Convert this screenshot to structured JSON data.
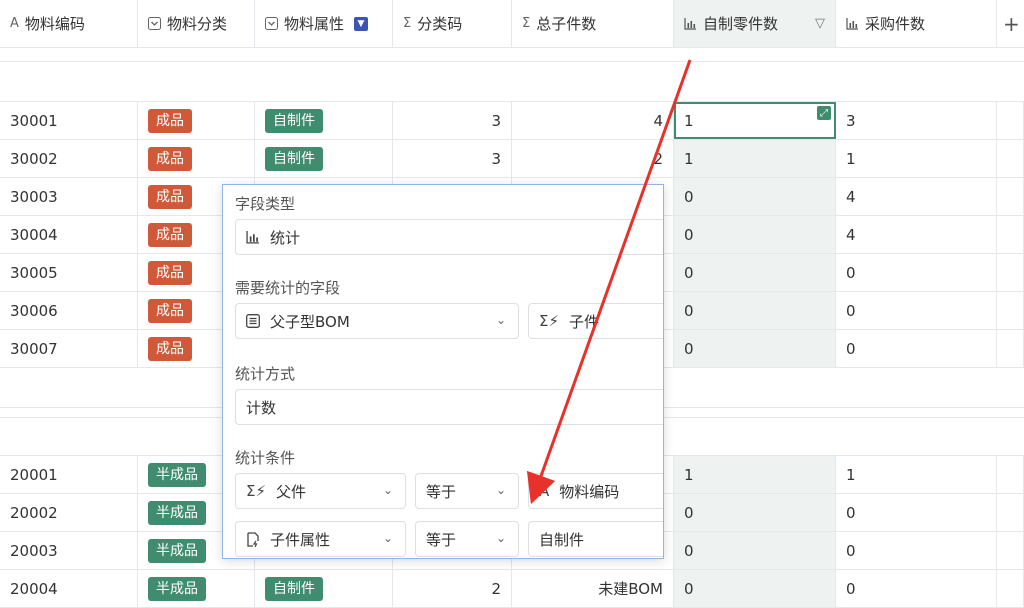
{
  "columns": [
    {
      "name": "物料编码",
      "icon": "text-icon"
    },
    {
      "name": "物料分类",
      "icon": "select-icon"
    },
    {
      "name": "物料属性",
      "icon": "select-icon"
    },
    {
      "name": "分类码",
      "icon": "sigma-icon"
    },
    {
      "name": "总子件数",
      "icon": "sigma-icon"
    },
    {
      "name": "自制零件数",
      "icon": "stats-icon"
    },
    {
      "name": "采购件数",
      "icon": "stats-icon"
    }
  ],
  "rows_group1": [
    {
      "code": "30001",
      "cat": "成品",
      "attr": "自制件",
      "classcode": "3",
      "total": "4",
      "self": "1",
      "buy": "3"
    },
    {
      "code": "30002",
      "cat": "成品",
      "attr": "自制件",
      "classcode": "3",
      "total": "2",
      "self": "1",
      "buy": "1"
    },
    {
      "code": "30003",
      "cat": "成品",
      "attr": "",
      "classcode": "",
      "total": "",
      "self": "0",
      "buy": "4"
    },
    {
      "code": "30004",
      "cat": "成品",
      "attr": "",
      "classcode": "",
      "total": "",
      "self": "0",
      "buy": "4"
    },
    {
      "code": "30005",
      "cat": "成品",
      "attr": "",
      "classcode": "",
      "total": "",
      "self": "0",
      "buy": "0"
    },
    {
      "code": "30006",
      "cat": "成品",
      "attr": "",
      "classcode": "",
      "total": "",
      "self": "0",
      "buy": "0"
    },
    {
      "code": "30007",
      "cat": "成品",
      "attr": "",
      "classcode": "",
      "total": "",
      "self": "0",
      "buy": "0"
    }
  ],
  "rows_group2": [
    {
      "code": "20001",
      "cat": "半成品",
      "attr": "",
      "classcode": "",
      "total": "",
      "self": "1",
      "buy": "1"
    },
    {
      "code": "20002",
      "cat": "半成品",
      "attr": "",
      "classcode": "",
      "total": "",
      "self": "0",
      "buy": "0"
    },
    {
      "code": "20003",
      "cat": "半成品",
      "attr": "",
      "classcode": "",
      "total": "",
      "self": "0",
      "buy": "0"
    },
    {
      "code": "20004",
      "cat": "半成品",
      "attr": "自制件",
      "classcode": "2",
      "total": "未建BOM",
      "self": "0",
      "buy": "0"
    }
  ],
  "panel": {
    "field_type_label": "字段类型",
    "field_type_value": "统计",
    "stat_field_label": "需要统计的字段",
    "stat_field_value": "父子型BOM",
    "stat_subfield_value": "子件",
    "stat_method_label": "统计方式",
    "stat_method_value": "计数",
    "conditions_label": "统计条件",
    "cond1": {
      "field": "父件",
      "op": "等于",
      "value": "物料编码"
    },
    "cond2": {
      "field": "子件属性",
      "op": "等于",
      "value": "自制件"
    }
  },
  "add_column_label": "+",
  "colors": {
    "accent": "#3f8c6f",
    "red_tag": "#d0593a",
    "arrow": "#e8312a",
    "filter": "#3a56b0"
  }
}
